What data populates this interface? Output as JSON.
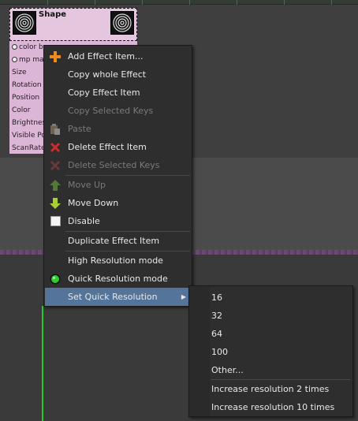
{
  "node": {
    "title": "Shape",
    "rows": [
      "color b",
      "mp ma",
      "Size",
      "Rotation",
      "Position",
      "Color",
      "Brightnes",
      "Visible Po",
      "ScanRate"
    ]
  },
  "menu": {
    "items": [
      {
        "label": "Add Effect Item...",
        "icon": "add-plus-icon",
        "enabled": true
      },
      {
        "label": "Copy whole Effect",
        "icon": "",
        "enabled": true
      },
      {
        "label": "Copy Effect Item",
        "icon": "",
        "enabled": true
      },
      {
        "label": "Copy Selected Keys",
        "icon": "",
        "enabled": false
      },
      {
        "label": "Paste",
        "icon": "paste-clipboard-icon",
        "enabled": false
      },
      {
        "label": "Delete Effect Item",
        "icon": "delete-x-icon",
        "enabled": true
      },
      {
        "label": "Delete Selected Keys",
        "icon": "delete-x-icon",
        "enabled": false
      },
      {
        "label": "Move Up",
        "icon": "arrow-up-icon",
        "enabled": false
      },
      {
        "label": "Move Down",
        "icon": "arrow-down-icon",
        "enabled": true
      },
      {
        "label": "Disable",
        "icon": "checkbox-icon",
        "enabled": true
      },
      {
        "label": "Duplicate Effect Item",
        "icon": "",
        "enabled": true
      },
      {
        "label": "High Resolution mode",
        "icon": "",
        "enabled": true
      },
      {
        "label": "Quick Resolution mode",
        "icon": "radio-selected-icon",
        "enabled": true
      },
      {
        "label": "Set Quick Resolution",
        "icon": "",
        "enabled": true,
        "submenu": true
      }
    ]
  },
  "submenu": {
    "items": [
      "16",
      "32",
      "64",
      "100",
      "Other..."
    ],
    "items2": [
      "Increase resolution 2 times",
      "Increase resolution 10 times"
    ]
  },
  "colors": {
    "menu_bg": "#2e2e2e",
    "selected": "#55749a",
    "node_bg": "#dbb6d6",
    "timeline_green": "#28c828"
  }
}
